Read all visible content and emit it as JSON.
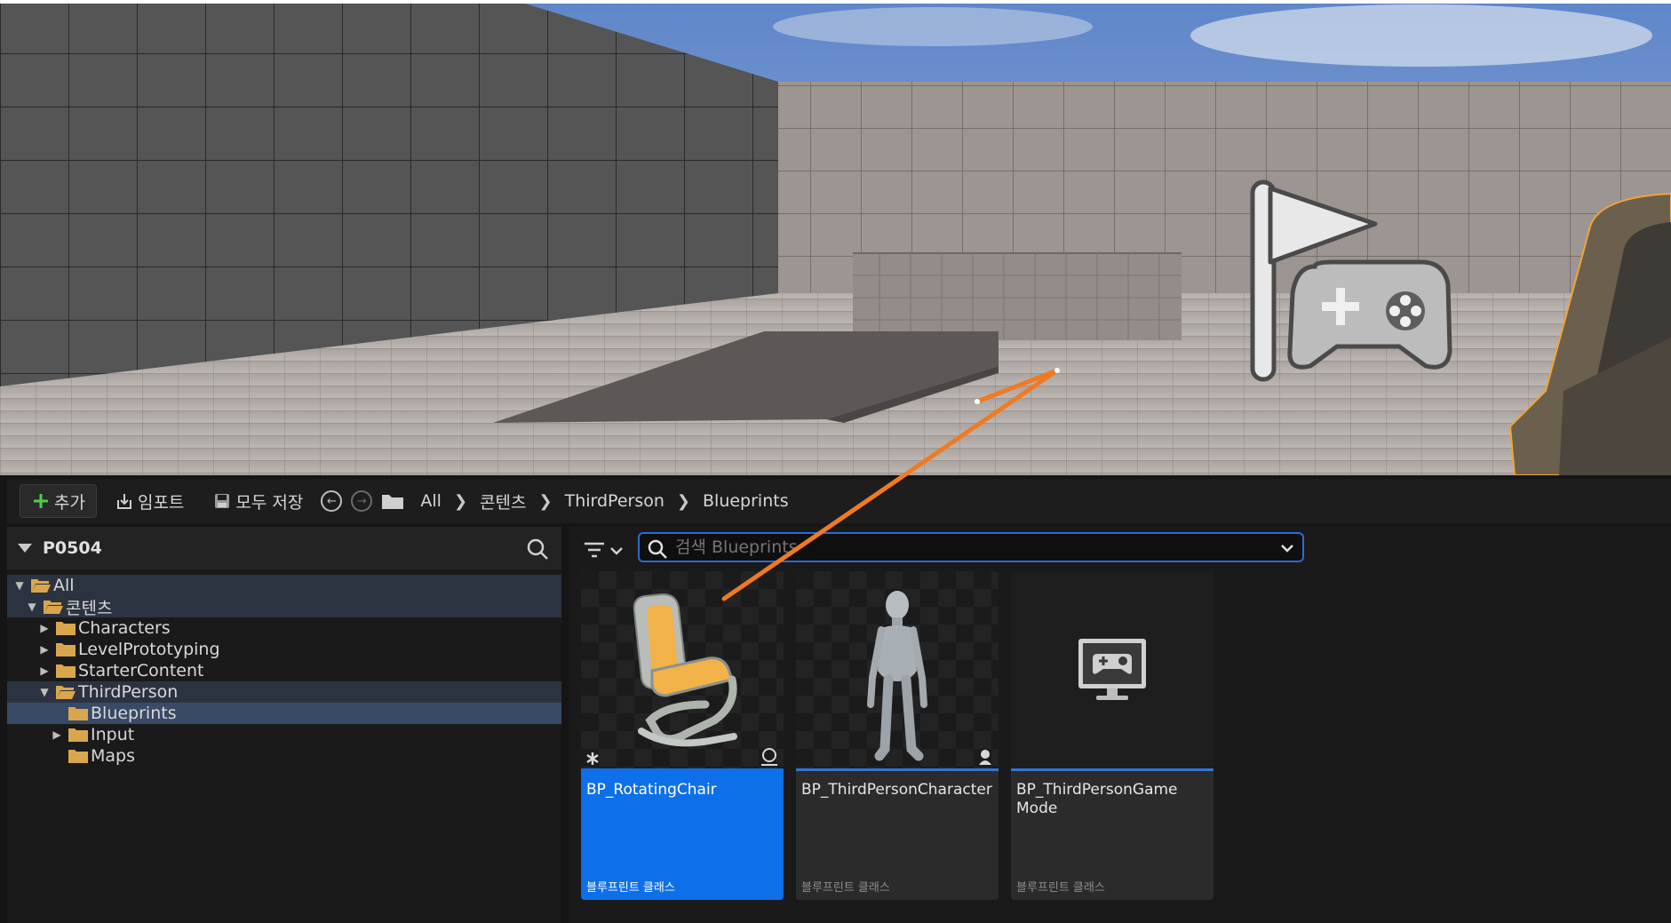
{
  "toolbar": {
    "add_label": "추가",
    "import_label": "임포트",
    "save_all_label": "모두 저장"
  },
  "breadcrumb": [
    "All",
    "콘텐츠",
    "ThirdPerson",
    "Blueprints"
  ],
  "sources": {
    "project_name": "P0504",
    "tree": [
      {
        "label": "All",
        "depth": 0,
        "expanded": true
      },
      {
        "label": "콘텐츠",
        "depth": 1,
        "expanded": true
      },
      {
        "label": "Characters",
        "depth": 2,
        "expanded": false
      },
      {
        "label": "LevelPrototyping",
        "depth": 2,
        "expanded": false
      },
      {
        "label": "StarterContent",
        "depth": 2,
        "expanded": false
      },
      {
        "label": "ThirdPerson",
        "depth": 2,
        "expanded": true
      },
      {
        "label": "Blueprints",
        "depth": 3,
        "selected": true
      },
      {
        "label": "Input",
        "depth": 3,
        "expanded": false
      },
      {
        "label": "Maps",
        "depth": 3
      }
    ]
  },
  "search": {
    "placeholder": "검색 Blueprints"
  },
  "assets": [
    {
      "name": "BP_RotatingChair",
      "type": "블루프린트 클래스",
      "selected": true,
      "icon": "chair-thumbnail"
    },
    {
      "name": "BP_ThirdPersonCharacter",
      "type": "블루프린트 클래스",
      "selected": false,
      "icon": "mannequin-thumbnail"
    },
    {
      "name": "BP_ThirdPersonGame Mode",
      "type": "블루프린트 클래스",
      "selected": false,
      "icon": "game-mode-icon"
    }
  ],
  "colors": {
    "selection": "#0e70e8",
    "accent_blue": "#2c6bd6",
    "annotation_arrow": "#f07a22",
    "folder": "#d9a64e"
  }
}
